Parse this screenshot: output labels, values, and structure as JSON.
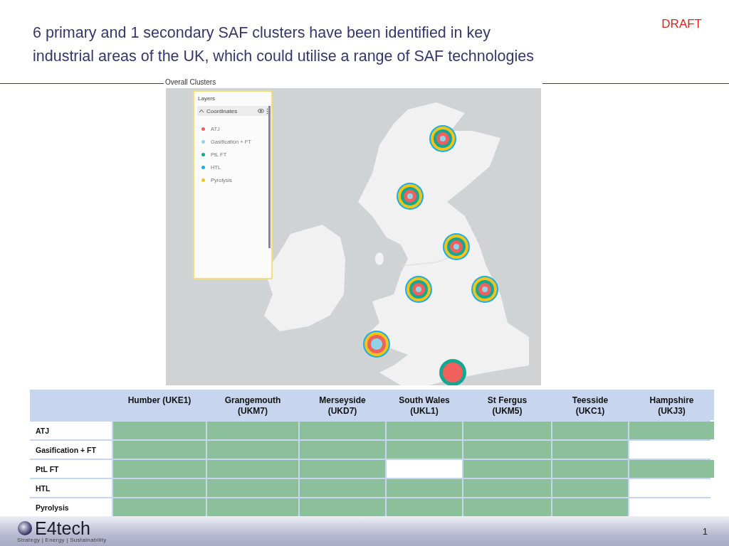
{
  "title": "6 primary and 1 secondary SAF clusters have been identified in key industrial areas of the UK, which could utilise a range of SAF technologies",
  "badge": "DRAFT",
  "map": {
    "caption": "Overall Clusters",
    "layers_panel": {
      "title": "Layers",
      "group": "Coordinates",
      "expanded": true,
      "items": [
        {
          "label": "ATJ",
          "color": "#f0605d"
        },
        {
          "label": "Gasification + FT",
          "color": "#8fd3e8"
        },
        {
          "label": "PtL FT",
          "color": "#14a894"
        },
        {
          "label": "HTL",
          "color": "#1aaee6"
        },
        {
          "label": "Pyrolysis",
          "color": "#f2c318"
        }
      ]
    }
  },
  "table": {
    "columns": [
      "Humber (UKE1)",
      "Grangemouth (UKM7)",
      "Merseyside (UKD7)",
      "South Wales (UKL1)",
      "St Fergus (UKM5)",
      "Teesside (UKC1)",
      "Hampshire (UKJ3)"
    ],
    "rows": [
      {
        "label": "ATJ",
        "cells": [
          {
            "on": true
          },
          {
            "on": true
          },
          {
            "on": true
          },
          {
            "on": true
          },
          {
            "on": true
          },
          {
            "on": true
          },
          {
            "on": true
          }
        ]
      },
      {
        "label": "Gasification + FT",
        "cells": [
          {
            "on": true
          },
          {
            "on": true
          },
          {
            "on": true
          },
          {
            "on": true
          },
          {
            "on": true
          },
          {
            "on": true
          },
          {
            "on": false
          }
        ]
      },
      {
        "label": "PtL FT",
        "cells": [
          {
            "on": true
          },
          {
            "on": true
          },
          {
            "on": true
          },
          {
            "on": false
          },
          {
            "on": true
          },
          {
            "on": true
          },
          {
            "on": true
          }
        ]
      },
      {
        "label": "HTL",
        "cells": [
          {
            "on": true
          },
          {
            "on": true
          },
          {
            "on": true
          },
          {
            "on": true
          },
          {
            "on": true
          },
          {
            "on": true
          },
          {
            "on": false
          }
        ]
      },
      {
        "label": "Pyrolysis",
        "cells": [
          {
            "on": true
          },
          {
            "on": true
          },
          {
            "on": true
          },
          {
            "on": true
          },
          {
            "on": true
          },
          {
            "on": true
          },
          {
            "on": false
          }
        ]
      }
    ]
  },
  "footer": {
    "logo": "E4tech",
    "tagline": "Strategy | Energy | Sustainability",
    "page_number": "1"
  }
}
